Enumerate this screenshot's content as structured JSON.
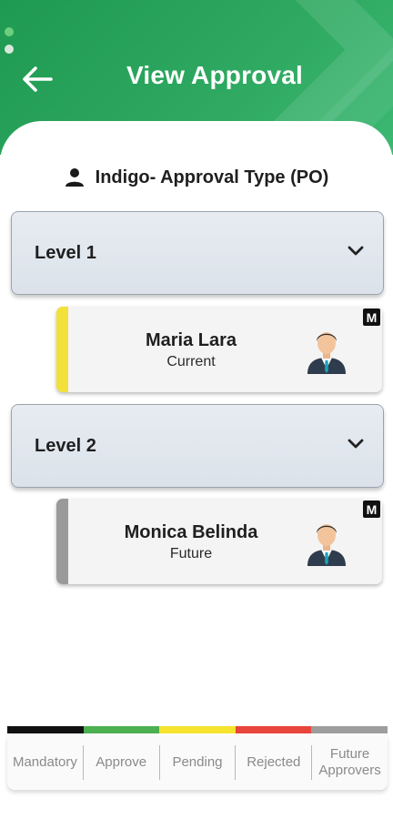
{
  "header": {
    "title": "View Approval",
    "back_icon": "arrow-left-icon",
    "color": "#2aa45b"
  },
  "approval_type": {
    "icon": "person-icon",
    "label": "Indigo- Approval Type (PO)"
  },
  "levels": [
    {
      "label": "Level 1",
      "approver": {
        "name": "Maria Lara",
        "status": "Current",
        "badge": "M",
        "status_color": "#f2e13a"
      }
    },
    {
      "label": "Level 2",
      "approver": {
        "name": "Monica Belinda",
        "status": "Future",
        "badge": "M",
        "status_color": "#9a9a9a"
      }
    }
  ],
  "legend": {
    "items": [
      {
        "label": "Mandatory",
        "color": "#111111"
      },
      {
        "label": "Approve",
        "color": "#4caf50"
      },
      {
        "label": "Pending",
        "color": "#f5e32e"
      },
      {
        "label": "Rejected",
        "color": "#e8453c"
      },
      {
        "label": "Future Approvers",
        "color": "#9e9e9e"
      }
    ]
  }
}
